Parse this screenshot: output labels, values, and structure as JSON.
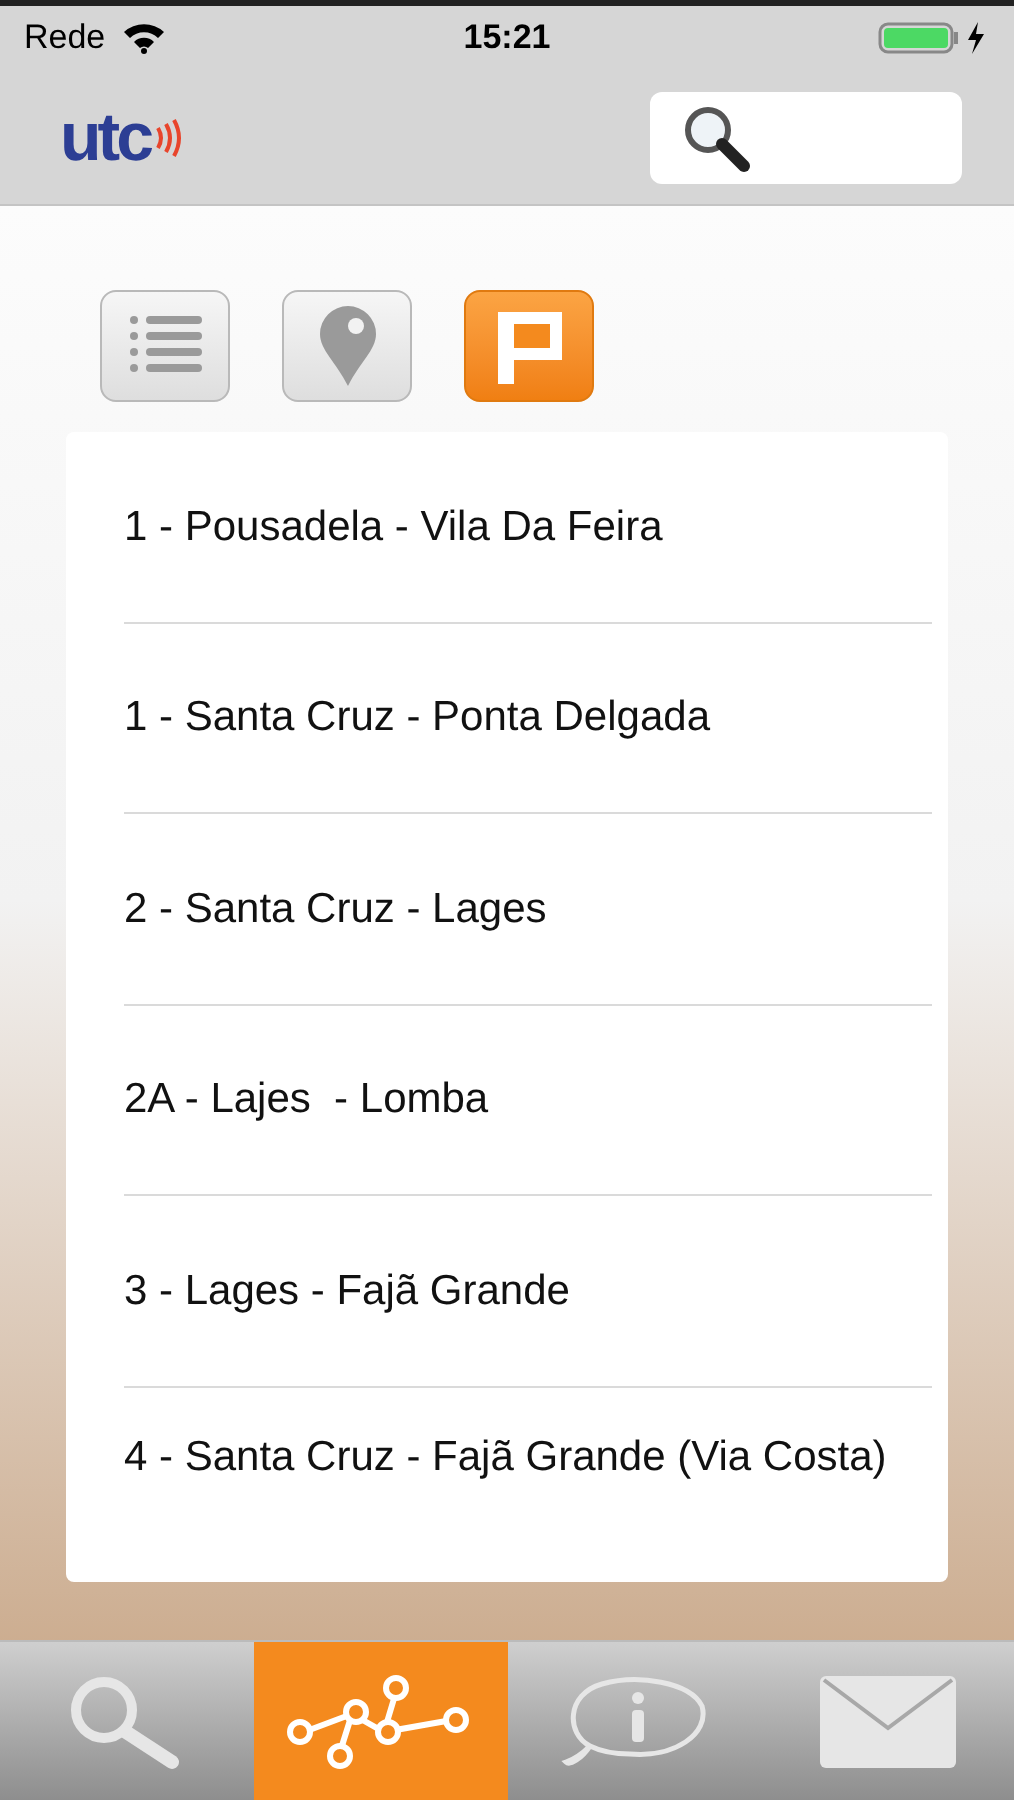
{
  "status_bar": {
    "carrier": "Rede",
    "time": "15:21"
  },
  "header": {
    "logo": "utc"
  },
  "view_toggles": [
    {
      "kind": "list",
      "selected": false
    },
    {
      "kind": "map",
      "selected": false
    },
    {
      "kind": "flag",
      "selected": true
    }
  ],
  "routes": [
    "1 - Pousadela - Vila Da Feira",
    "1 - Santa Cruz - Ponta Delgada",
    "2 - Santa Cruz - Lages",
    "2A - Lajes  - Lomba",
    "3 - Lages - Fajã Grande",
    "4 - Santa Cruz - Fajã Grande (Via Costa)"
  ],
  "tab_bar": [
    {
      "kind": "search",
      "selected": false
    },
    {
      "kind": "routes",
      "selected": true
    },
    {
      "kind": "info",
      "selected": false
    },
    {
      "kind": "mail",
      "selected": false
    }
  ]
}
